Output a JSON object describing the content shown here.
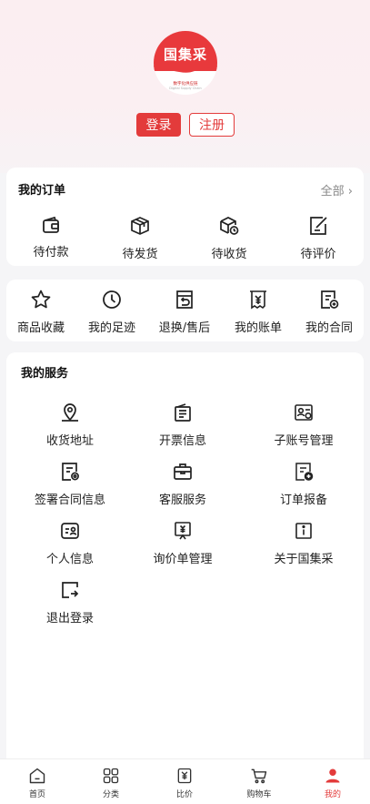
{
  "brand": {
    "name": "国集采",
    "tagline": "数字化供应链",
    "tagline_en": "Digital Supply Chain"
  },
  "auth": {
    "login_label": "登录",
    "register_label": "注册"
  },
  "orders": {
    "title": "我的订单",
    "all_label": "全部",
    "items": [
      {
        "label": "待付款",
        "icon": "wallet-icon"
      },
      {
        "label": "待发货",
        "icon": "package-icon"
      },
      {
        "label": "待收货",
        "icon": "delivery-box-icon"
      },
      {
        "label": "待评价",
        "icon": "edit-review-icon"
      }
    ]
  },
  "quick": {
    "items": [
      {
        "label": "商品收藏",
        "icon": "star-icon"
      },
      {
        "label": "我的足迹",
        "icon": "clock-icon"
      },
      {
        "label": "退换/售后",
        "icon": "return-icon"
      },
      {
        "label": "我的账单",
        "icon": "bill-icon"
      },
      {
        "label": "我的合同",
        "icon": "contract-icon"
      }
    ]
  },
  "services": {
    "title": "我的服务",
    "items": [
      {
        "label": "收货地址",
        "icon": "location-icon"
      },
      {
        "label": "开票信息",
        "icon": "invoice-icon"
      },
      {
        "label": "子账号管理",
        "icon": "sub-account-icon"
      },
      {
        "label": "签署合同信息",
        "icon": "sign-contract-icon"
      },
      {
        "label": "客服服务",
        "icon": "briefcase-icon"
      },
      {
        "label": "订单报备",
        "icon": "order-report-icon"
      },
      {
        "label": "个人信息",
        "icon": "profile-card-icon"
      },
      {
        "label": "询价单管理",
        "icon": "inquiry-icon"
      },
      {
        "label": "关于国集采",
        "icon": "info-icon"
      },
      {
        "label": "退出登录",
        "icon": "logout-icon"
      }
    ]
  },
  "tabbar": {
    "items": [
      {
        "label": "首页",
        "icon": "home-icon"
      },
      {
        "label": "分类",
        "icon": "category-icon"
      },
      {
        "label": "比价",
        "icon": "price-compare-icon"
      },
      {
        "label": "购物车",
        "icon": "cart-icon"
      },
      {
        "label": "我的",
        "icon": "user-icon",
        "active": true
      }
    ]
  },
  "colors": {
    "accent": "#e33b3b",
    "background": "#f5f5f7",
    "hero": "#fbeef1"
  }
}
